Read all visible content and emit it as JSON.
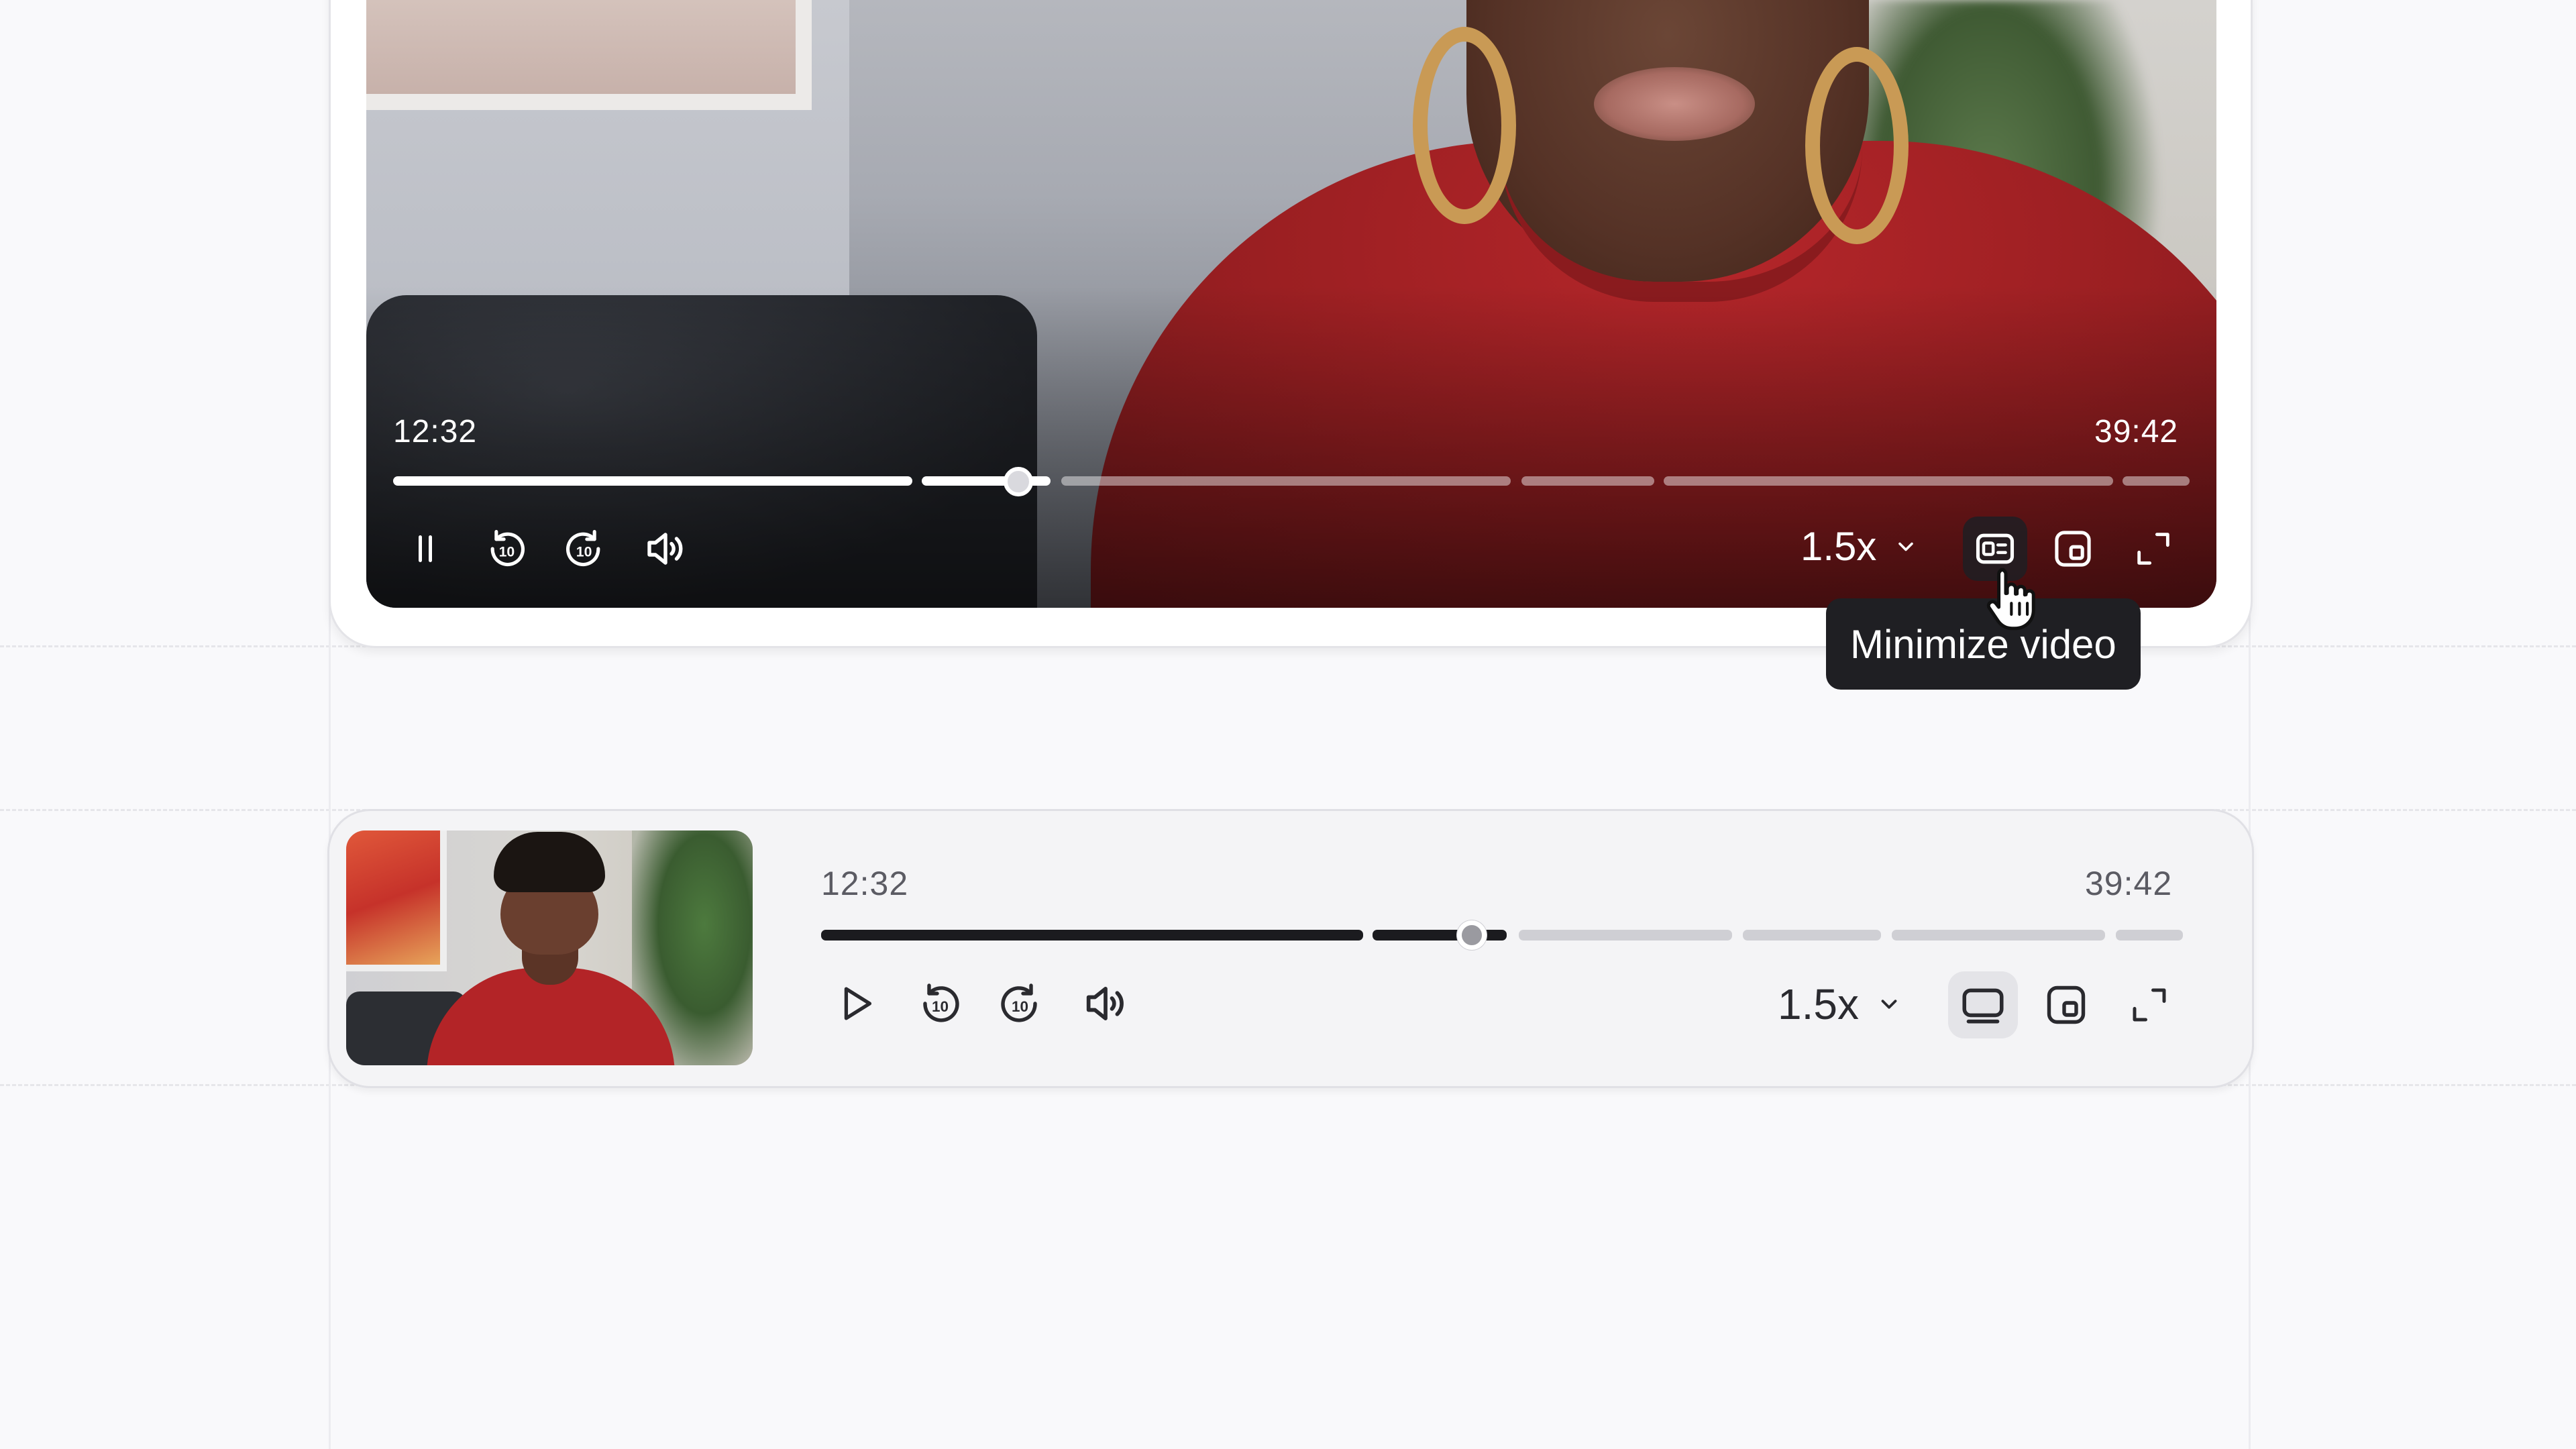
{
  "big_player": {
    "current_time": "12:32",
    "duration": "39:42",
    "progress_fraction": 0.316,
    "speed": "1.5x",
    "state": "playing",
    "tooltip": "Minimize video",
    "controls": [
      "pause-icon",
      "rewind-10-icon",
      "forward-10-icon",
      "volume-icon",
      "chevron-down-icon",
      "minimize-video-icon",
      "picture-in-picture-icon",
      "fullscreen-icon"
    ]
  },
  "mini_player": {
    "current_time": "12:32",
    "duration": "39:42",
    "progress_fraction": 0.316,
    "speed": "1.5x",
    "state": "paused",
    "controls": [
      "play-icon",
      "rewind-10-icon",
      "forward-10-icon",
      "volume-icon",
      "chevron-down-icon",
      "theater-mode-icon",
      "picture-in-picture-icon",
      "fullscreen-icon"
    ]
  },
  "colors": {
    "tooltip_bg": "#1f1f23",
    "progress_played_dark": "#1b1b1f",
    "progress_unplayed_light": "#cfcfd4",
    "sweater_red": "#9b1f22"
  }
}
